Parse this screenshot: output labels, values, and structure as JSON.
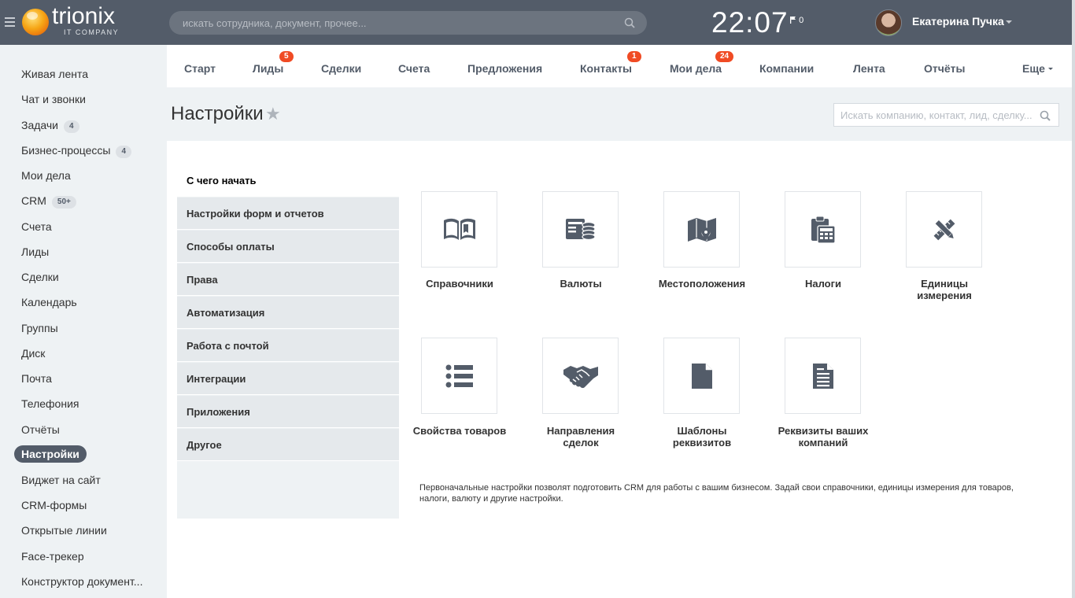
{
  "header": {
    "logo_text": "trionix",
    "logo_sub": "IT COMPANY",
    "search_placeholder": "искать сотрудника, документ, прочее...",
    "clock": "22:07",
    "notifications": "0",
    "user_name": "Екатерина Пучка"
  },
  "sidebar": {
    "items": [
      {
        "label": "Живая лента"
      },
      {
        "label": "Чат и звонки"
      },
      {
        "label": "Задачи",
        "count": "4"
      },
      {
        "label": "Бизнес-процессы",
        "count": "4"
      },
      {
        "label": "Мои дела"
      },
      {
        "label": "CRM",
        "count": "50+"
      },
      {
        "label": "Счета"
      },
      {
        "label": "Лиды"
      },
      {
        "label": "Сделки"
      },
      {
        "label": "Календарь"
      },
      {
        "label": "Группы"
      },
      {
        "label": "Диск"
      },
      {
        "label": "Почта"
      },
      {
        "label": "Телефония"
      },
      {
        "label": "Отчёты"
      },
      {
        "label": "Настройки",
        "active": true
      },
      {
        "label": "Виджет на сайт"
      },
      {
        "label": "CRM-формы"
      },
      {
        "label": "Открытые линии"
      },
      {
        "label": "Face-трекер"
      },
      {
        "label": "Конструктор документ..."
      }
    ]
  },
  "tabs": [
    {
      "label": "Старт"
    },
    {
      "label": "Лиды",
      "badge": "5"
    },
    {
      "label": "Сделки"
    },
    {
      "label": "Счета"
    },
    {
      "label": "Предложения"
    },
    {
      "label": "Контакты",
      "badge": "1"
    },
    {
      "label": "Мои дела",
      "badge": "24"
    },
    {
      "label": "Компании"
    },
    {
      "label": "Лента"
    },
    {
      "label": "Отчёты"
    },
    {
      "label": "Еще"
    }
  ],
  "page": {
    "title": "Настройки",
    "crm_search_placeholder": "Искать компанию, контакт, лид, сделку..."
  },
  "settings_nav": [
    {
      "label": "С чего начать",
      "active": true
    },
    {
      "label": "Настройки форм и отчетов"
    },
    {
      "label": "Способы оплаты"
    },
    {
      "label": "Права"
    },
    {
      "label": "Автоматизация"
    },
    {
      "label": "Работа с почтой"
    },
    {
      "label": "Интеграции"
    },
    {
      "label": "Приложения"
    },
    {
      "label": "Другое"
    }
  ],
  "tiles": [
    {
      "label": "Справочники",
      "icon": "book-icon"
    },
    {
      "label": "Валюты",
      "icon": "currency-icon"
    },
    {
      "label": "Местоположения",
      "icon": "map-icon"
    },
    {
      "label": "Налоги",
      "icon": "tax-calculator-icon"
    },
    {
      "label": "Единицы измерения",
      "icon": "ruler-pencil-icon"
    },
    {
      "label": "Свойства товаров",
      "icon": "list-icon"
    },
    {
      "label": "Направления сделок",
      "icon": "handshake-icon"
    },
    {
      "label": "Шаблоны реквизитов",
      "icon": "document-template-icon"
    },
    {
      "label": "Реквизиты ваших компаний",
      "icon": "document-text-icon"
    }
  ],
  "description": "Первоначальные настройки позволят подготовить CRM для работы с вашим бизнесом. Задай свои справочники, единицы измерения для товаров, налоги, валюту и другие настройки.",
  "colors": {
    "header_bg": "#535c69",
    "badge": "#f04b24",
    "icon": "#535c69",
    "page_bg": "#eef2f4"
  }
}
